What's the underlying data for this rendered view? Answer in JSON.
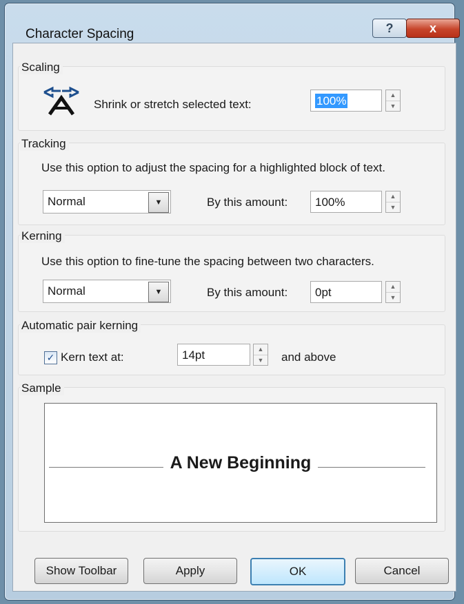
{
  "window": {
    "title": "Character Spacing",
    "help_label": "?",
    "close_label": "x"
  },
  "scaling": {
    "group_label": "Scaling",
    "label": "Shrink or stretch selected text:",
    "value": "100%"
  },
  "tracking": {
    "group_label": "Tracking",
    "description": "Use this option to adjust the spacing for a highlighted block of text.",
    "mode": "Normal",
    "amount_label": "By this amount:",
    "amount": "100%"
  },
  "kerning": {
    "group_label": "Kerning",
    "description": "Use this option to fine-tune the spacing between two characters.",
    "mode": "Normal",
    "amount_label": "By this amount:",
    "amount": "0pt"
  },
  "auto_kerning": {
    "group_label": "Automatic pair kerning",
    "checkbox_label": "Kern text at:",
    "checked": true,
    "value": "14pt",
    "suffix": "and above"
  },
  "sample": {
    "group_label": "Sample",
    "text": "A New Beginning"
  },
  "buttons": {
    "show_toolbar": "Show Toolbar",
    "apply": "Apply",
    "ok": "OK",
    "cancel": "Cancel"
  }
}
